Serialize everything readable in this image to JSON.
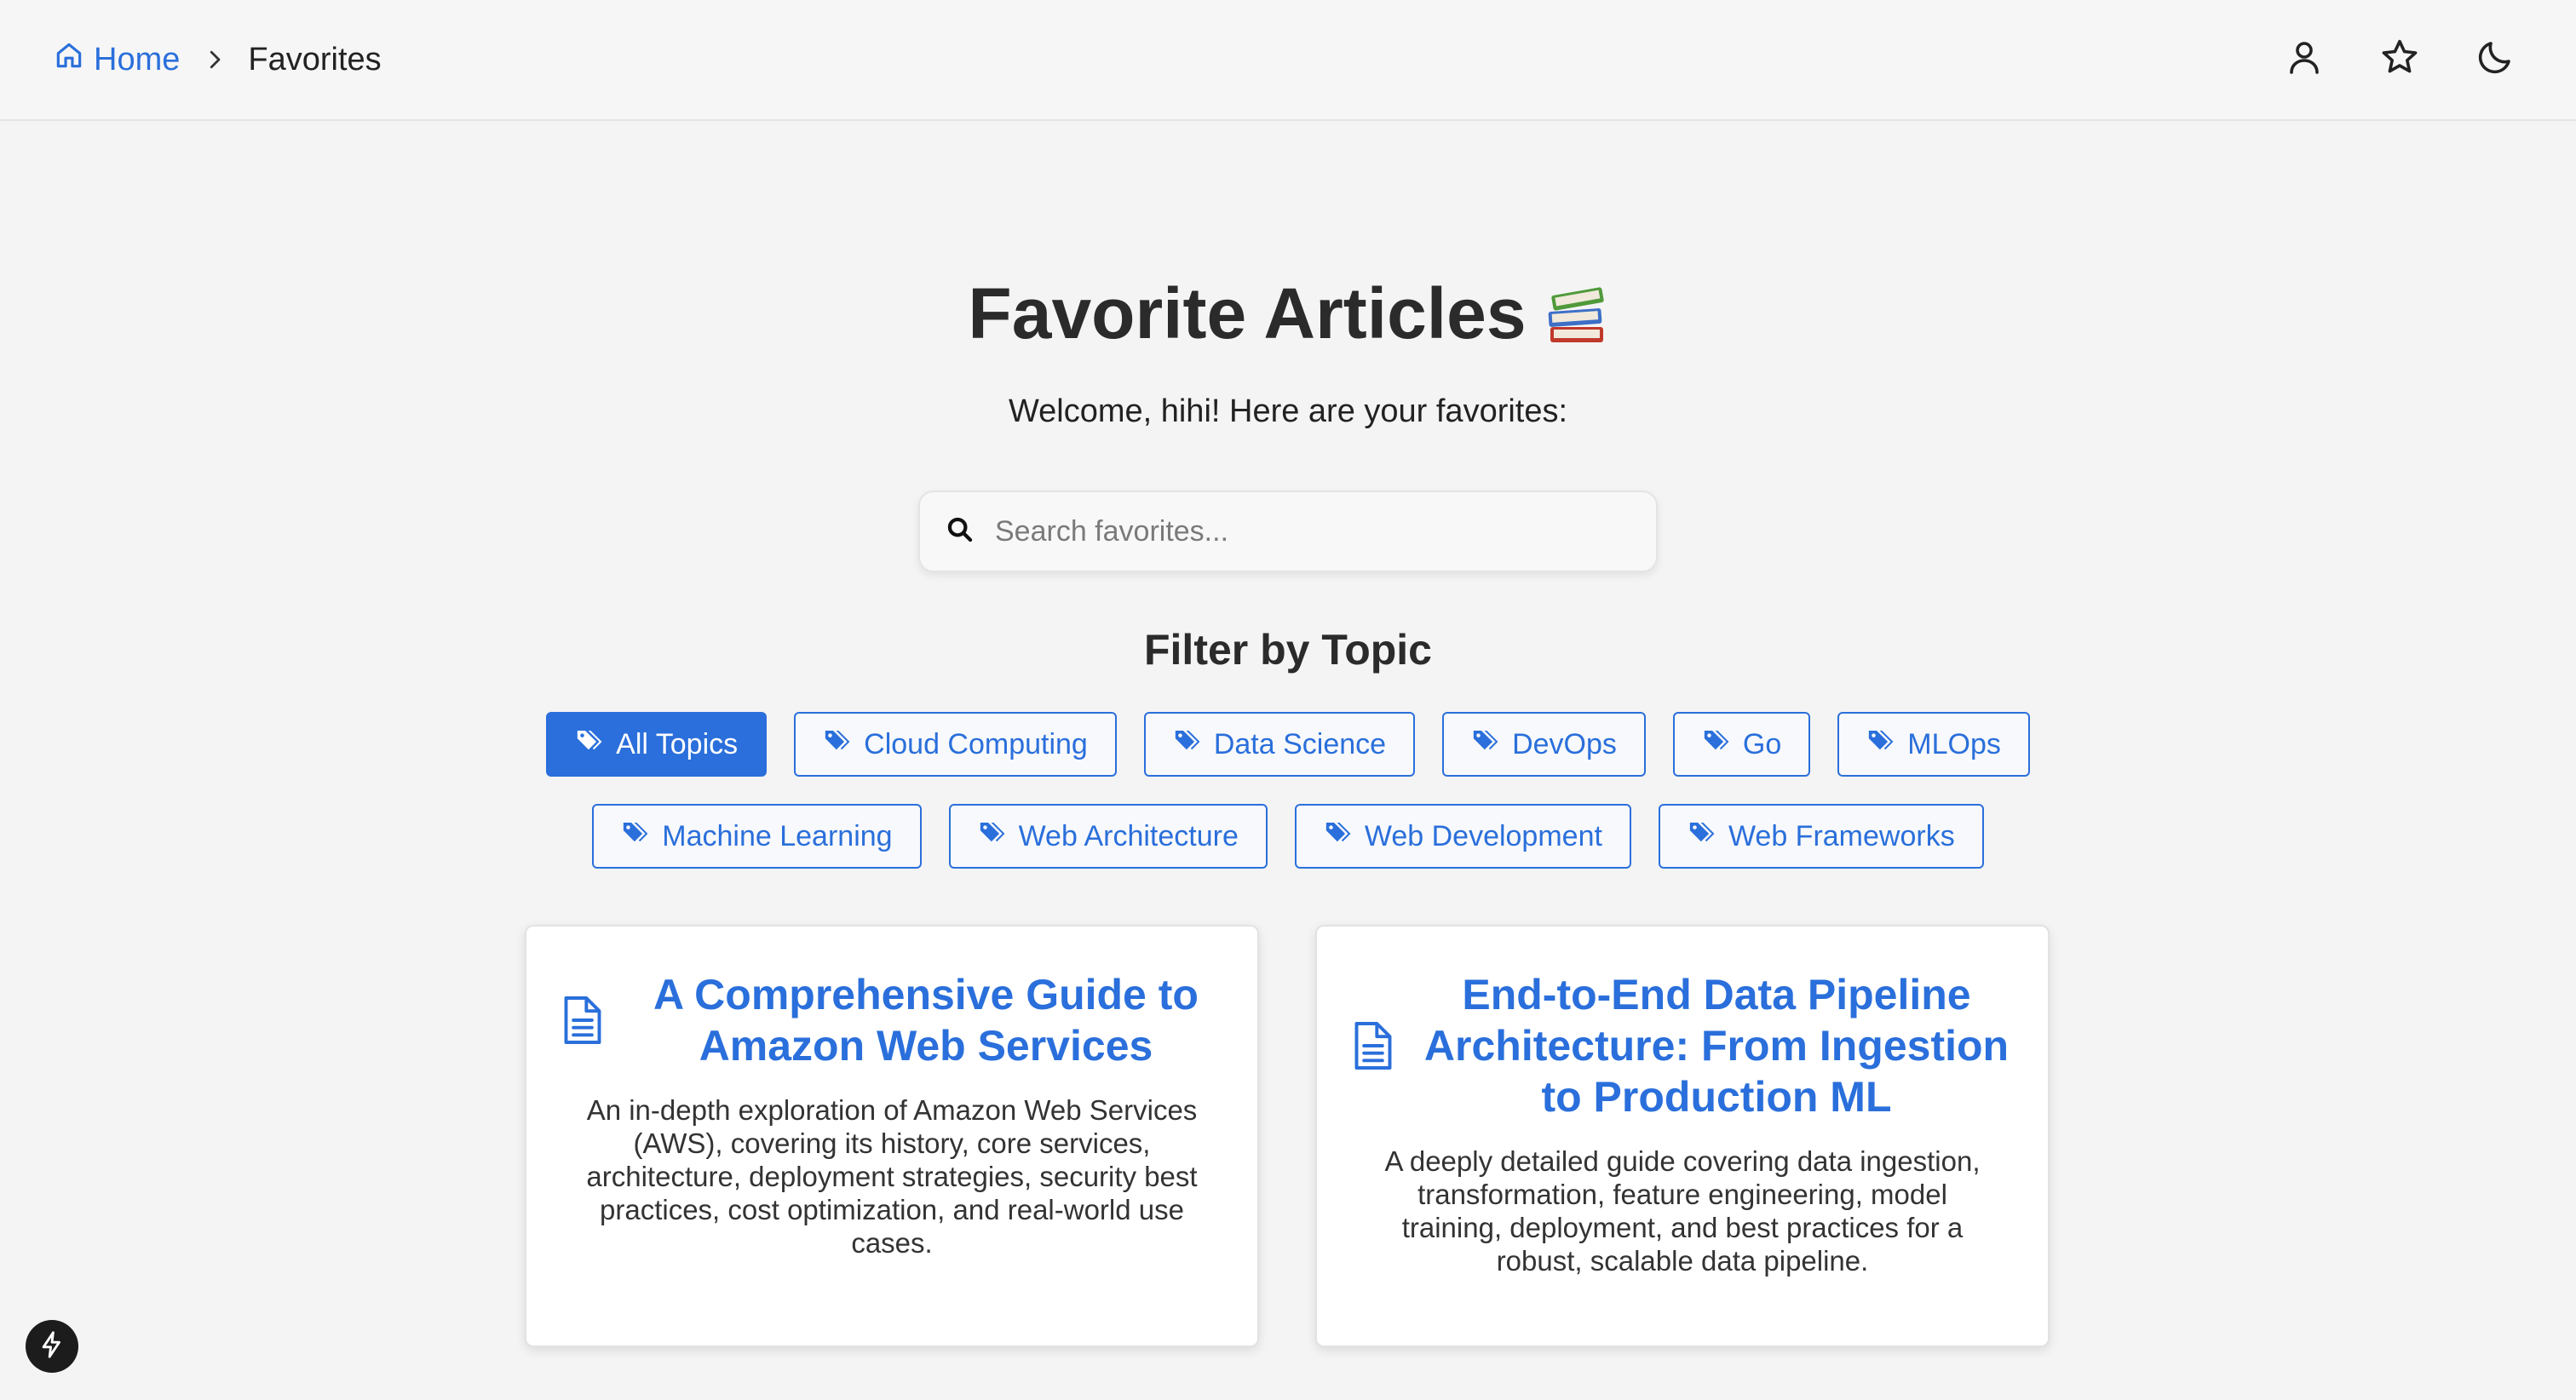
{
  "breadcrumb": {
    "home_label": "Home",
    "current_label": "Favorites"
  },
  "header_icons": [
    "user-icon",
    "star-icon",
    "moon-icon"
  ],
  "hero": {
    "title": "Favorite Articles",
    "title_emoji_icon": "books-icon",
    "welcome": "Welcome, hihi! Here are your favorites:"
  },
  "search": {
    "placeholder": "Search favorites...",
    "value": ""
  },
  "filter": {
    "title": "Filter by Topic",
    "active": "All Topics",
    "topics_row1": [
      "All Topics",
      "Cloud Computing",
      "Data Science",
      "DevOps",
      "Go",
      "MLOps"
    ],
    "topics_row2": [
      "Machine Learning",
      "Web Architecture",
      "Web Development",
      "Web Frameworks"
    ]
  },
  "articles": [
    {
      "title_lines": [
        "A Comprehensive Guide to",
        "Amazon Web Services"
      ],
      "description_lines": [
        "An in-depth exploration of Amazon Web Services",
        "(AWS), covering its history, core services,",
        "architecture, deployment strategies, security best",
        "practices, cost optimization, and real-world use",
        "cases."
      ]
    },
    {
      "title_lines": [
        "End-to-End Data Pipeline",
        "Architecture: From Ingestion",
        "to Production ML"
      ],
      "description_lines": [
        "A deeply detailed guide covering data ingestion,",
        "transformation, feature engineering, model",
        "training, deployment, and best practices for a",
        "robust, scalable data pipeline."
      ]
    }
  ],
  "colors": {
    "accent": "#2a6fdb",
    "background": "#f4f4f4",
    "card": "#ffffff",
    "title_text": "#2b2b2b"
  }
}
